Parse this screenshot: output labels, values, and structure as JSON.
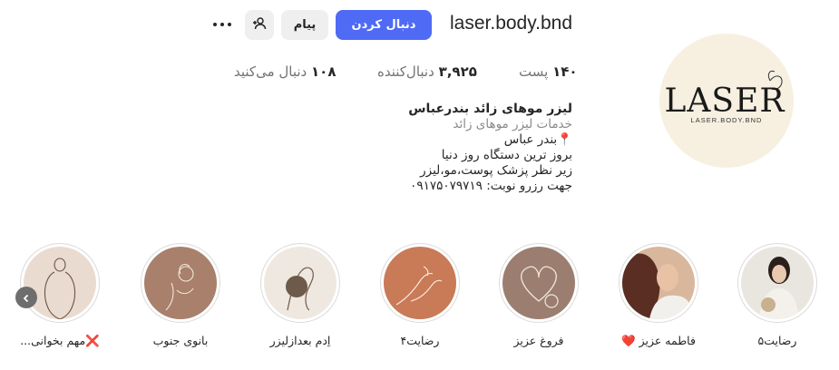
{
  "profile": {
    "username": "laser.body.bnd",
    "follow_label": "دنبال کردن",
    "message_label": "پیام",
    "add_user_icon": "add-user-icon",
    "more_icon": "more-options-icon"
  },
  "stats": {
    "posts_count": "۱۴۰",
    "posts_label": "پست",
    "followers_count": "۳,۹۲۵",
    "followers_label": "دنبال‌کننده",
    "following_count": "۱۰۸",
    "following_label": "دنبال می‌کنید"
  },
  "avatar": {
    "logo_text": "LASER",
    "logo_sub": "LASER.BODY.BND"
  },
  "bio": {
    "name": "لیزر موهای زائد بندرعباس",
    "category": "خدمات لیزر موهای زائد",
    "line1": "📍بندر عباس",
    "line2": "بروز ترین دستگاه روز دنیا",
    "line3": "زیر نظر پزشک پوست،مو،لیزر",
    "line4": "جهت رزرو نوبت: ۰۹۱۷۵۰۷۹۷۱۹"
  },
  "highlights": [
    {
      "label": "رضایت۵"
    },
    {
      "label": "فاطمه عزیز ❤️"
    },
    {
      "label": "فروغ عزیز"
    },
    {
      "label": "رضایت۴"
    },
    {
      "label": "اِدم بعدازلیزر"
    },
    {
      "label": "بانوی جنوب"
    },
    {
      "label": "❌مهم بخوانی..."
    }
  ],
  "colors": {
    "accent": "#4f6af5",
    "button_gray": "#efefef"
  }
}
